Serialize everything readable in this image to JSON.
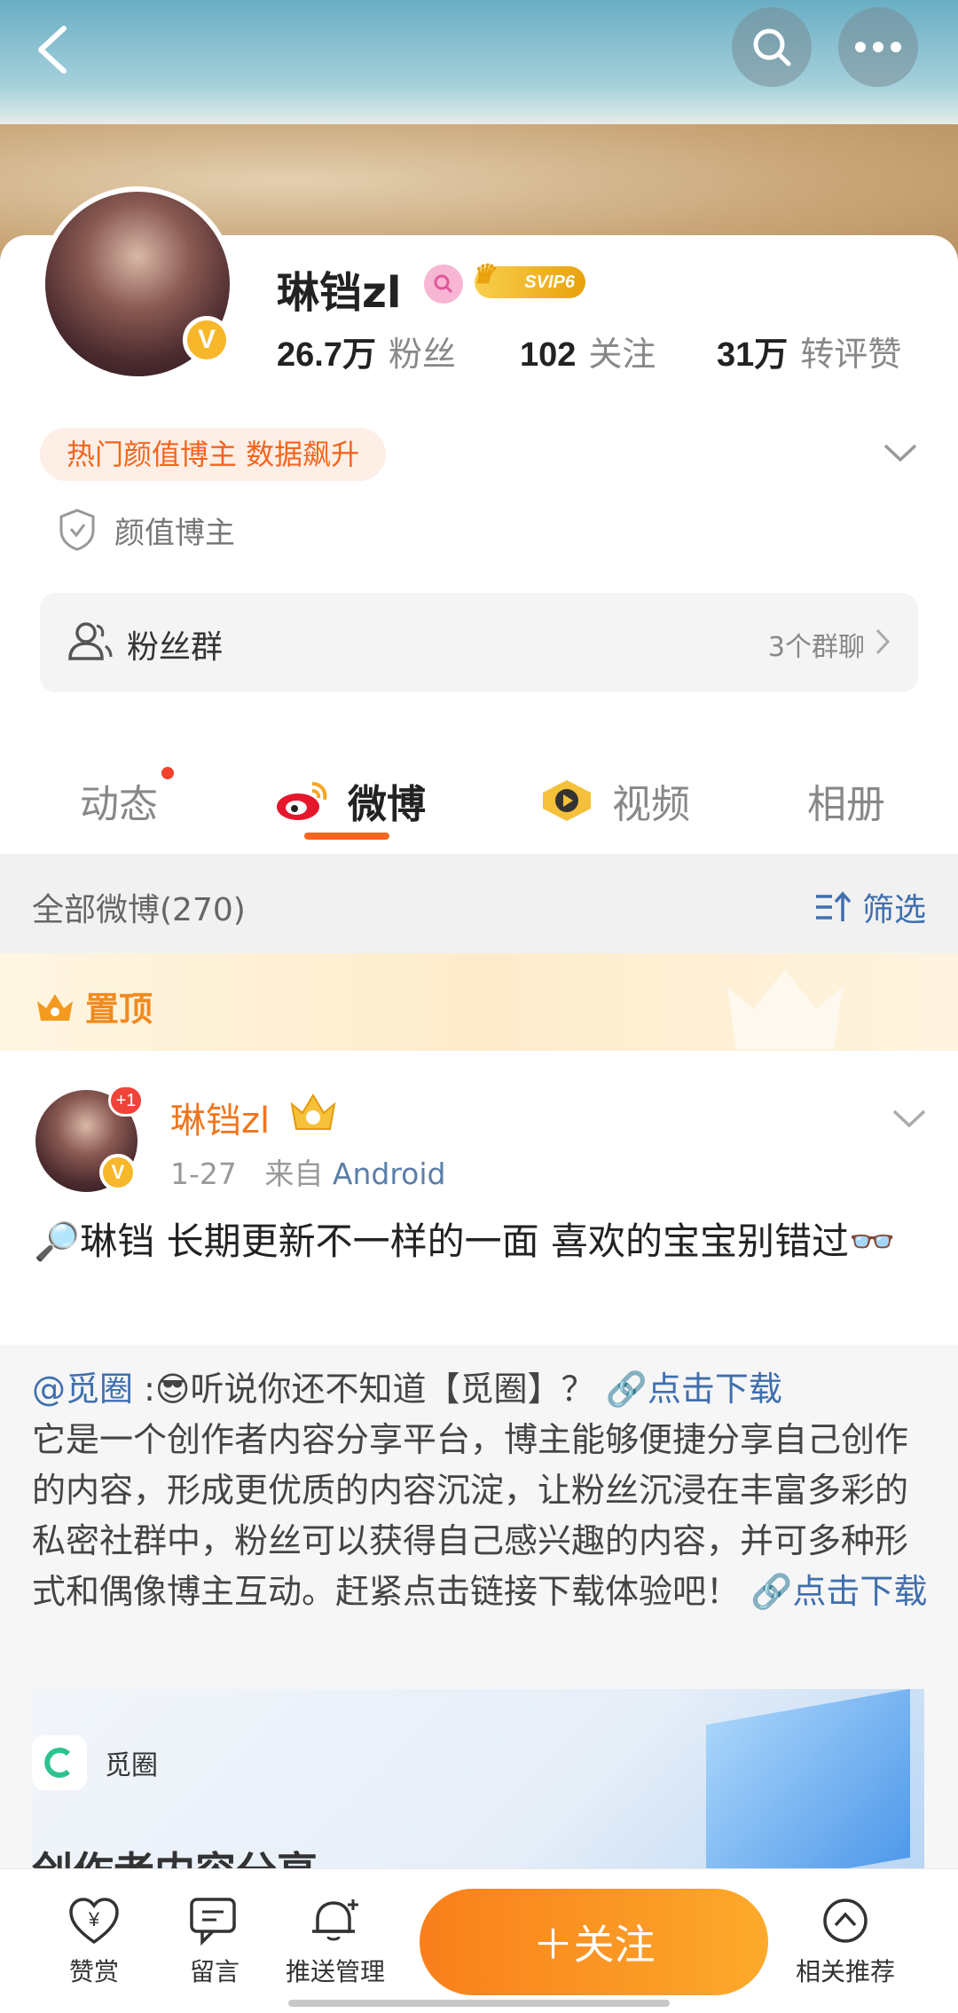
{
  "profile": {
    "name": "琳铛zl",
    "vip_label": "SVIP6",
    "verified_mark": "V",
    "stats": [
      {
        "value": "26.7万",
        "label": "粉丝"
      },
      {
        "value": "102",
        "label": "关注"
      },
      {
        "value": "31万",
        "label": "转评赞"
      }
    ],
    "hot_tag": "热门颜值博主 数据飙升",
    "verify_label": "颜值博主"
  },
  "fans_group": {
    "label": "粉丝群",
    "count": "3个群聊"
  },
  "tabs": [
    {
      "label": "动态",
      "has_dot": true
    },
    {
      "label": "微博",
      "active": true
    },
    {
      "label": "视频"
    },
    {
      "label": "相册"
    }
  ],
  "filter": {
    "all_label": "全部微博(270)",
    "filter_label": "筛选"
  },
  "pinned": {
    "label": "置顶"
  },
  "post": {
    "author": "琳铛zl",
    "badge": "+1",
    "date": "1-27",
    "source_prefix": "来自",
    "source": "Android",
    "text": "🔎琳铛 长期更新不一样的一面 喜欢的宝宝别错过👓"
  },
  "repost": {
    "mention": "@觅圈",
    "intro": " :😎听说你还不知道【觅圈】？ ",
    "link1": "🔗点击下载",
    "body": "它是一个创作者内容分享平台，博主能够便捷分享自己创作的内容，形成更优质的内容沉淀，让粉丝沉浸在丰富多彩的私密社群中，粉丝可以获得自己感兴趣的内容，并可多种形式和偶像博主互动。赶紧点击链接下载体验吧！ ",
    "link2": "🔗点击下载",
    "media_app": "觅圈",
    "media_partial_text": "创作者内容分享"
  },
  "bottom_bar": {
    "reward": "赞赏",
    "message": "留言",
    "push": "推送管理",
    "follow": "＋关注",
    "related": "相关推荐"
  },
  "colors": {
    "accent": "#f5651d",
    "link": "#3f6fae",
    "name_orange": "#f0761e"
  }
}
